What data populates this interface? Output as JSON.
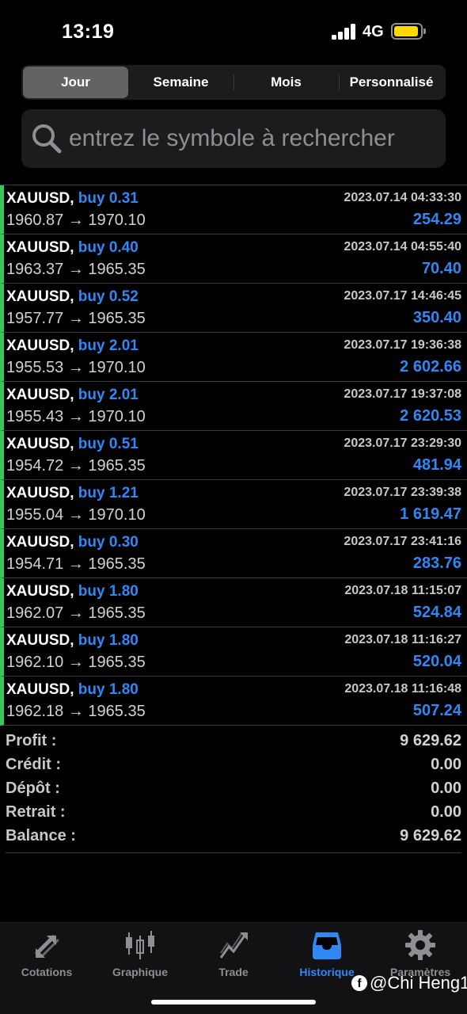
{
  "status_bar": {
    "time": "13:19",
    "network": "4G"
  },
  "segments": [
    "Jour",
    "Semaine",
    "Mois",
    "Personnalisé"
  ],
  "active_segment": "Jour",
  "search": {
    "placeholder": "entrez le symbole à rechercher"
  },
  "trades": [
    {
      "symbol": "XAUUSD,",
      "side": "buy 0.31",
      "open": "1960.87",
      "arrow": "→",
      "close": "1970.10",
      "datetime": "2023.07.14 04:33:30",
      "profit": "254.29"
    },
    {
      "symbol": "XAUUSD,",
      "side": "buy 0.40",
      "open": "1963.37",
      "arrow": "→",
      "close": "1965.35",
      "datetime": "2023.07.14 04:55:40",
      "profit": "70.40"
    },
    {
      "symbol": "XAUUSD,",
      "side": "buy 0.52",
      "open": "1957.77",
      "arrow": "→",
      "close": "1965.35",
      "datetime": "2023.07.17 14:46:45",
      "profit": "350.40"
    },
    {
      "symbol": "XAUUSD,",
      "side": "buy 2.01",
      "open": "1955.53",
      "arrow": "→",
      "close": "1970.10",
      "datetime": "2023.07.17 19:36:38",
      "profit": "2 602.66"
    },
    {
      "symbol": "XAUUSD,",
      "side": "buy 2.01",
      "open": "1955.43",
      "arrow": "→",
      "close": "1970.10",
      "datetime": "2023.07.17 19:37:08",
      "profit": "2 620.53"
    },
    {
      "symbol": "XAUUSD,",
      "side": "buy 0.51",
      "open": "1954.72",
      "arrow": "→",
      "close": "1965.35",
      "datetime": "2023.07.17 23:29:30",
      "profit": "481.94"
    },
    {
      "symbol": "XAUUSD,",
      "side": "buy 1.21",
      "open": "1955.04",
      "arrow": "→",
      "close": "1970.10",
      "datetime": "2023.07.17 23:39:38",
      "profit": "1 619.47"
    },
    {
      "symbol": "XAUUSD,",
      "side": "buy 0.30",
      "open": "1954.71",
      "arrow": "→",
      "close": "1965.35",
      "datetime": "2023.07.17 23:41:16",
      "profit": "283.76"
    },
    {
      "symbol": "XAUUSD,",
      "side": "buy 1.80",
      "open": "1962.07",
      "arrow": "→",
      "close": "1965.35",
      "datetime": "2023.07.18 11:15:07",
      "profit": "524.84"
    },
    {
      "symbol": "XAUUSD,",
      "side": "buy 1.80",
      "open": "1962.10",
      "arrow": "→",
      "close": "1965.35",
      "datetime": "2023.07.18 11:16:27",
      "profit": "520.04"
    },
    {
      "symbol": "XAUUSD,",
      "side": "buy 1.80",
      "open": "1962.18",
      "arrow": "→",
      "close": "1965.35",
      "datetime": "2023.07.18 11:16:48",
      "profit": "507.24"
    }
  ],
  "summary": [
    {
      "label": "Profit :",
      "value": "9 629.62"
    },
    {
      "label": "Crédit :",
      "value": "0.00"
    },
    {
      "label": "Dépôt :",
      "value": "0.00"
    },
    {
      "label": "Retrait :",
      "value": "0.00"
    },
    {
      "label": "Balance :",
      "value": "9 629.62"
    }
  ],
  "tabs": [
    {
      "label": "Cotations",
      "icon": "quotes-arrows-icon"
    },
    {
      "label": "Graphique",
      "icon": "candlestick-chart-icon"
    },
    {
      "label": "Trade",
      "icon": "trade-trend-icon"
    },
    {
      "label": "Historique",
      "icon": "history-inbox-icon"
    },
    {
      "label": "Paramètres",
      "icon": "gear-icon"
    }
  ],
  "active_tab": "Historique",
  "watermark": {
    "text": "@Chi Heng1",
    "badge": "f"
  },
  "colors": {
    "accent": "#2f88f6",
    "profit_bar": "#34c759",
    "background": "#000000",
    "battery": "#ffd60a"
  }
}
